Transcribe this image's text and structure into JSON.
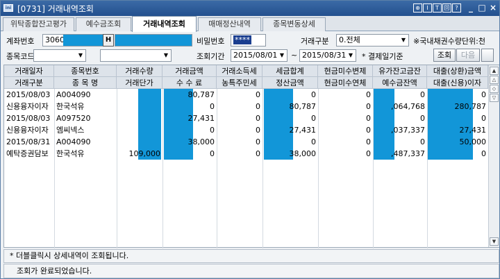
{
  "window": {
    "title": "[0731] 거래내역조회",
    "logo_text": "ini",
    "tool_buttons": [
      "⊕",
      "I",
      "T",
      "回",
      "?"
    ],
    "win_buttons": [
      "_",
      "□",
      "×"
    ]
  },
  "tabs": [
    {
      "label": "위탁종합잔고평가"
    },
    {
      "label": "예수금조회"
    },
    {
      "label": "거래내역조회"
    },
    {
      "label": "매매정산내역"
    },
    {
      "label": "종목변동상세"
    }
  ],
  "form": {
    "account_label": "계좌번호",
    "account_value": "3060",
    "account_btn": "H",
    "password_label": "비밀번호",
    "password_value": "****",
    "trade_type_label": "거래구분",
    "trade_type_value": "0.전체",
    "note": "※국내채권수량단위:천",
    "code_label": "종목코드",
    "period_label": "조회기간",
    "date_from": "2015/08/01",
    "tilde": "~",
    "date_to": "2015/08/31",
    "basis": "* 결제일기준",
    "query_btn": "조회",
    "next_btn": "다음"
  },
  "grid": {
    "header_row1": [
      "거래일자",
      "종목번호",
      "거래수량",
      "거래금액",
      "거래소득세",
      "세금합계",
      "현금미수변제",
      "유가잔고금잔",
      "대출(상환)금액"
    ],
    "header_row2": [
      "거래구분",
      "종 목 명",
      "거래단가",
      "수  수  료",
      "농특주민세",
      "정산금액",
      "현금미수연체",
      "예수금잔액",
      "대출(신용)이자"
    ],
    "rows": [
      [
        "2015/08/03",
        "A004090",
        "",
        "80,787",
        "0",
        "0",
        "0",
        "0",
        "0"
      ],
      [
        "신용융자이자",
        "한국석유",
        "",
        "0",
        "0",
        "80,787",
        "0",
        ",064,768",
        "280,787"
      ],
      [
        "2015/08/03",
        "A097520",
        "",
        "27,431",
        "0",
        "0",
        "0",
        "0",
        "0"
      ],
      [
        "신용융자이자",
        "엠씨넥스",
        "",
        "0",
        "0",
        "27,431",
        "0",
        ",037,337",
        "27,431"
      ],
      [
        "2015/08/31",
        "A004090",
        "",
        "38,000",
        "0",
        "0",
        "0",
        "0",
        "50,000"
      ],
      [
        "예탁증권담보",
        "한국석유",
        "109,000",
        "0",
        "0",
        "38,000",
        "0",
        ",487,337",
        "0"
      ]
    ]
  },
  "footer": {
    "hint": "* 더블클릭시 상세내역이 조회됩니다.",
    "status": "조회가 완료되었습니다."
  }
}
